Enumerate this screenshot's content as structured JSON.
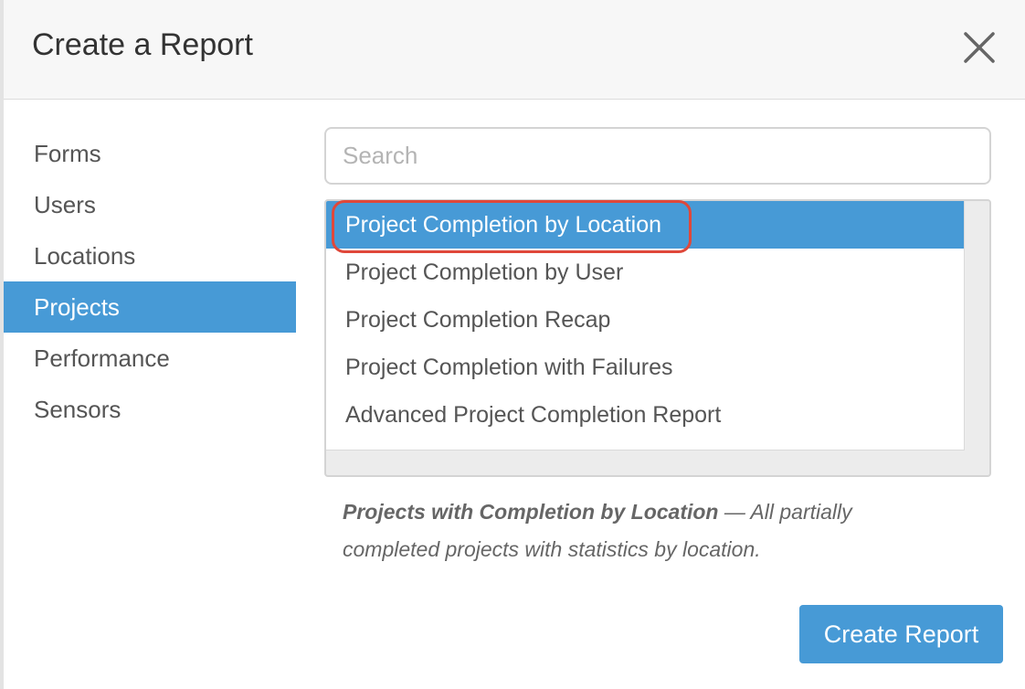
{
  "dialog": {
    "title": "Create a Report",
    "close_icon": "close-x-icon"
  },
  "sidebar": {
    "items": [
      {
        "label": "Forms",
        "active": false
      },
      {
        "label": "Users",
        "active": false
      },
      {
        "label": "Locations",
        "active": false
      },
      {
        "label": "Projects",
        "active": true
      },
      {
        "label": "Performance",
        "active": false
      },
      {
        "label": "Sensors",
        "active": false
      }
    ]
  },
  "search": {
    "placeholder": "Search",
    "value": ""
  },
  "reports": {
    "items": [
      {
        "label": "Project Completion by Location",
        "selected": true
      },
      {
        "label": "Project Completion by User",
        "selected": false
      },
      {
        "label": "Project Completion Recap",
        "selected": false
      },
      {
        "label": "Project Completion with Failures",
        "selected": false
      },
      {
        "label": "Advanced Project Completion Report",
        "selected": false
      }
    ]
  },
  "description": {
    "title": "Projects with Completion by Location",
    "separator": " — ",
    "text": "All partially completed projects with statistics by location."
  },
  "actions": {
    "create_label": "Create Report"
  },
  "colors": {
    "accent": "#479ad6",
    "highlight_ring": "#e0483a",
    "header_bg": "#f7f7f7",
    "text": "#555555"
  }
}
